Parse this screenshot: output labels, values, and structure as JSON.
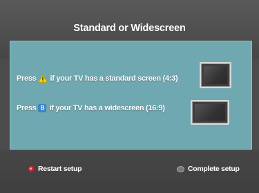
{
  "title": "Standard or Widescreen",
  "rows": {
    "standard": {
      "prefix": "Press",
      "suffix": "if your TV has a standard screen (4:3)",
      "key_icon": "yellow-triangle-warning-icon"
    },
    "wide": {
      "prefix": "Press",
      "suffix": "if your TV has a widescreen (16:9)",
      "key_icon": "blue-b-button-icon",
      "key_letter": "B"
    }
  },
  "footer": {
    "restart_label": "Restart setup",
    "complete_label": "Complete setup",
    "restart_icon": "red-button-icon",
    "complete_icon": "ok-button-icon"
  },
  "colors": {
    "background": "#4b4b4b",
    "panel": "#6fa8b0",
    "accent_red": "#e02828",
    "accent_blue": "#3a86c8",
    "accent_yellow": "#f2d21a"
  }
}
